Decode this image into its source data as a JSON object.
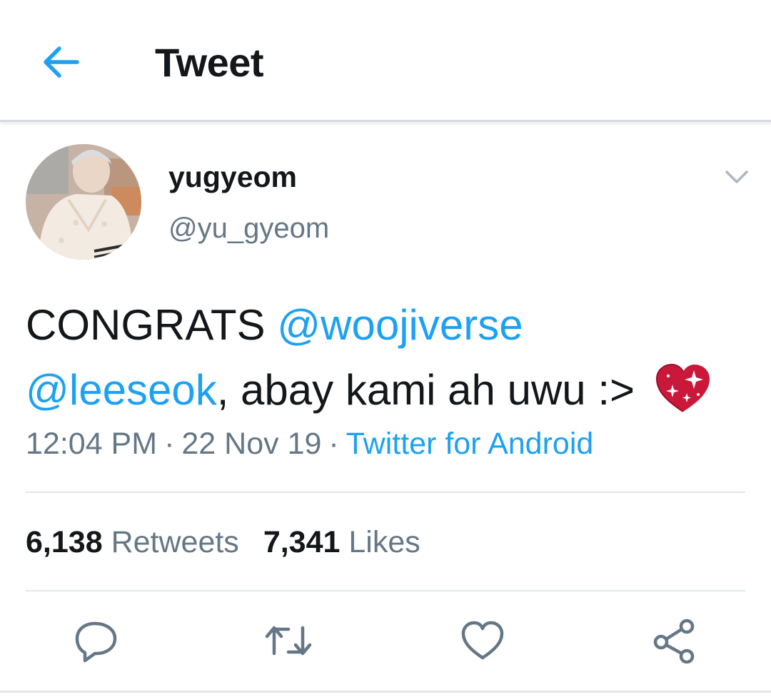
{
  "header": {
    "title": "Tweet",
    "back_icon": "arrow-left-icon",
    "accent_color": "#1da1f2"
  },
  "tweet": {
    "author": {
      "display_name": "yugyeom",
      "handle": "@yu_gyeom"
    },
    "text": {
      "lead": "CONGRATS ",
      "mention_1": "@woojiverse",
      "mention_2": "@leeseok",
      "rest": ", abay kami ah uwu :> ",
      "emoji": "sparkling-heart-emoji"
    },
    "time": "12:04 PM",
    "date": "22 Nov 19",
    "separator": "·",
    "source": "Twitter for Android"
  },
  "stats": {
    "retweets_count": "6,138",
    "retweets_label": "Retweets",
    "likes_count": "7,341",
    "likes_label": "Likes"
  },
  "actions": [
    "reply-icon",
    "retweet-icon",
    "like-icon",
    "share-icon"
  ],
  "colors": {
    "text": "#14171a",
    "secondary": "#657786",
    "link": "#1da1f2",
    "divider": "#e1e8ed"
  }
}
